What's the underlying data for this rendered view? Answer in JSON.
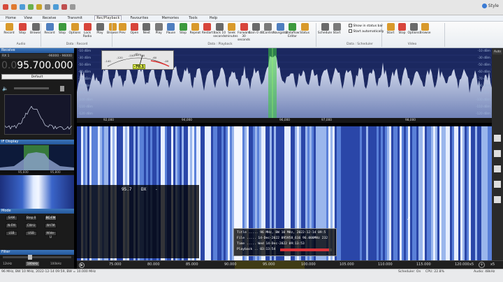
{
  "quick_access_colors": [
    "#d64a3a",
    "#e07a2f",
    "#4d9cd6",
    "#6ab04c",
    "#c9a227",
    "#8a8a8a",
    "#4d9cd6",
    "#c05050",
    "#999"
  ],
  "menus": [
    "Home",
    "View",
    "Receive",
    "Transmit",
    "Rec/Playback",
    "Favourites",
    "Memories",
    "Tools",
    "Help"
  ],
  "menu_active_index": 4,
  "window_right": {
    "style_label": "Style"
  },
  "ribbon": {
    "audio": {
      "group": "Audio",
      "buttons": [
        "Record",
        "Stop",
        "Browse"
      ]
    },
    "record": {
      "group": "Data : Record",
      "buttons": [
        "Record",
        "Stop",
        "Options",
        "Lock Radio",
        "Play",
        "Browse"
      ]
    },
    "playback": {
      "group": "Data : Playback",
      "buttons": [
        "Prev",
        "Open",
        "Next",
        "Play",
        "Pause",
        "Stop",
        "Repeat",
        "Restart",
        "Back 10 seconds",
        "Seek minutes",
        "Forward 30 seconds",
        "Gain 0 dB",
        "Contro",
        "Navigator",
        "Dataflow Editor",
        "Status"
      ]
    },
    "scheduler": {
      "group": "Data : Scheduler",
      "buttons": [
        "Schedule",
        "Start"
      ],
      "checks": [
        "Show in status bar",
        "Start automatically"
      ]
    },
    "video": {
      "group": "Video",
      "buttons": [
        "Start",
        "Stop",
        "Options",
        "Browse"
      ]
    }
  },
  "left": {
    "receive_title": "Receive",
    "rx_label": "RX 1",
    "rx_range": "-96000 - 96000",
    "freq_prefix": "0.0",
    "freq_main": "95.700.000",
    "default_label": "Default",
    "display_title": "IF Display",
    "if_ticks": [
      "95,600",
      "95,800"
    ],
    "mode_title": "Mode",
    "filter_title": "Filter",
    "modes": [
      "SAM",
      "Step II",
      "BC-FM",
      "N-FM",
      "CW-U",
      "W-FM",
      "LSB",
      "USB",
      "Wide-U"
    ],
    "mode_selected": "BC-FM",
    "filter_labels": [
      "12kHz",
      "180kHz",
      "100kHz"
    ]
  },
  "spectrum": {
    "db_labels": [
      "-10 dBm",
      "-30 dBm",
      "-50 dBm",
      "-60 dBm",
      "-70 dBm",
      "-80 dBm",
      "-90 dBm",
      "-100 dBm",
      "-110 dBm",
      "-120 dBm"
    ],
    "freq_ticks": [
      "92,000",
      "94,000",
      "96,000",
      "97,000",
      "98,000"
    ],
    "meter_value": "-70.1",
    "meter_scale": [
      "-140",
      "-120",
      "-100",
      "-80",
      "-60",
      "-40"
    ],
    "meter_unit": "dBm"
  },
  "dx_overlay": {
    "freq": "95.7",
    "type": "DX",
    "dash": "-"
  },
  "playback_info": {
    "title_line": "Title ..... 96 MHz, BW 10 MHz, 2022-12-14 09:5",
    "file_line": "File ..... 14-Dec-2022 095958_616 96.000MHz 232",
    "time_line": "Time ..... Wed 14-Dec-2022 09:13:53",
    "playback_line": "Playback .. 03:13:54",
    "progress": 0.94
  },
  "scale": {
    "ticks": [
      "75.000",
      "80.000",
      "85.000",
      "90.000",
      "95.000",
      "100.000",
      "105.000",
      "110.000",
      "115.000",
      "120.000"
    ],
    "zoom_left": "x5",
    "zoom_right": "x5"
  },
  "status": {
    "left": "96 MHz, BW 10 MHz, 2022-12-14 09:59, BW = 10.000 MHz",
    "scheduler": "Scheduler: On",
    "cpu": "CPU: 22.8%",
    "audio": "Audio: 48kHz"
  }
}
